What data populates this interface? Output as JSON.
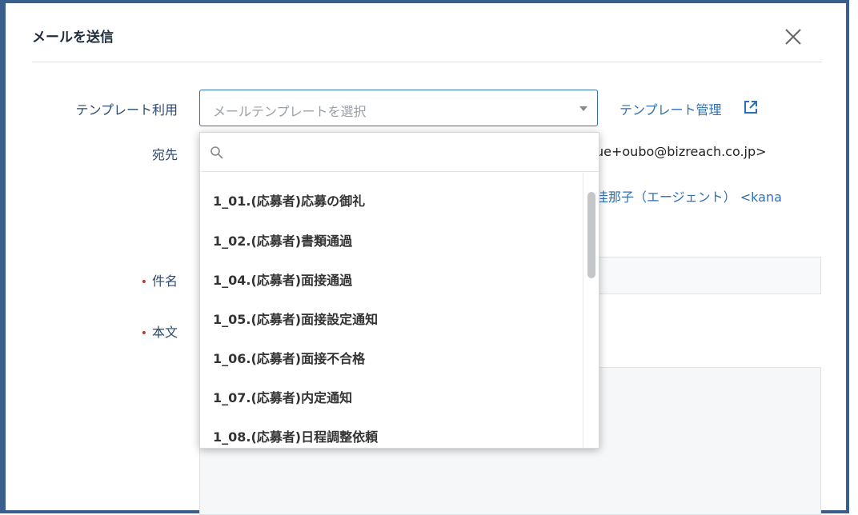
{
  "dialog": {
    "title": "メールを送信",
    "close_label": "×"
  },
  "form": {
    "template_label": "テンプレート利用",
    "template_placeholder": "メールテンプレートを選択",
    "template_manage_link": "テンプレート管理",
    "to_label": "宛先",
    "to_address_partial": "ue+oubo@bizreach.co.jp>",
    "agent_partial": "佳那子（エージェント） <kana",
    "subject_label": "件名",
    "body_label": "本文",
    "required_mark": "•"
  },
  "dropdown": {
    "search_placeholder": "",
    "items": [
      "1_01.(応募者)応募の御礼",
      "1_02.(応募者)書類通過",
      "1_04.(応募者)面接通過",
      "1_05.(応募者)面接設定通知",
      "1_06.(応募者)面接不合格",
      "1_07.(応募者)内定通知",
      "1_08.(応募者)日程調整依頼"
    ]
  },
  "colors": {
    "frame": "#3b5f8c",
    "accent": "#2f6fb5",
    "label": "#2b4a6f",
    "required": "#c0392b"
  }
}
